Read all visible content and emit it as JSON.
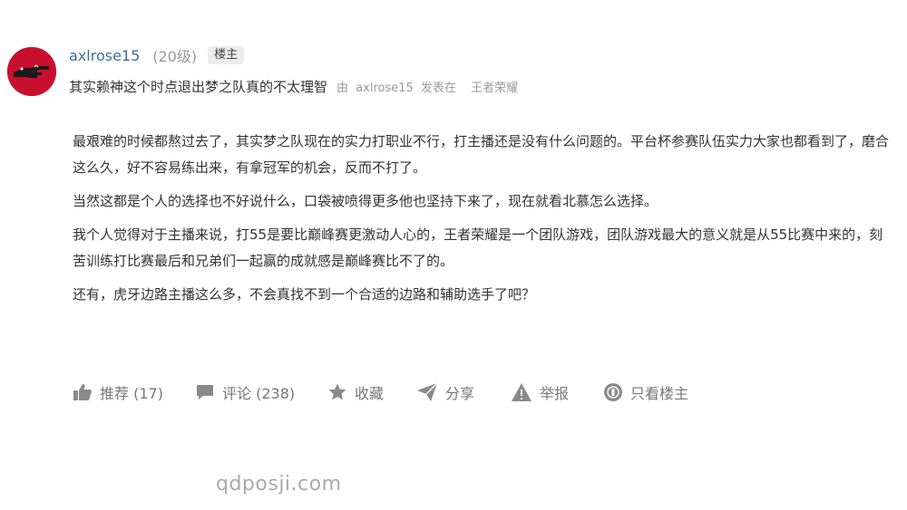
{
  "post": {
    "author": {
      "username": "axlrose15",
      "level": "(20级)",
      "badge": "楼主"
    },
    "title": "其实赖神这个时点退出梦之队真的不太理智",
    "meta": {
      "by": "由",
      "author": "axlrose15",
      "posted_in": "发表在",
      "forum": "王者荣耀"
    },
    "paragraphs": [
      "最艰难的时候都熬过去了，其实梦之队现在的实力打职业不行，打主播还是没有什么问题的。平台杯参赛队伍实力大家也都看到了，磨合这么久，好不容易练出来，有拿冠军的机会，反而不打了。",
      "当然这都是个人的选择也不好说什么，口袋被喷得更多他也坚持下来了，现在就看北慕怎么选择。",
      "我个人觉得对于主播来说，打55是要比巅峰赛更激动人心的，王者荣耀是一个团队游戏，团队游戏最大的意义就是从55比赛中来的，刻苦训练打比赛最后和兄弟们一起赢的成就感是巅峰赛比不了的。",
      "还有，虎牙边路主播这么多，不会真找不到一个合适的边路和辅助选手了吧？"
    ]
  },
  "actions": {
    "like": {
      "label": "推荐 (17)",
      "icon": "thumbs-up-icon"
    },
    "comment": {
      "label": "评论 (238)",
      "icon": "comment-icon"
    },
    "favorite": {
      "label": "收藏",
      "icon": "star-icon"
    },
    "share": {
      "label": "分享",
      "icon": "paper-plane-icon"
    },
    "report": {
      "label": "举报",
      "icon": "warning-icon"
    },
    "owner_only": {
      "label": "只看楼主",
      "icon": "owner-icon"
    }
  },
  "watermark": "qdposji.com",
  "colors": {
    "username": "#3f6f96",
    "avatar_bg": "#c8102e",
    "action_gray": "#777777",
    "icon_gray": "#8a8a8a"
  }
}
